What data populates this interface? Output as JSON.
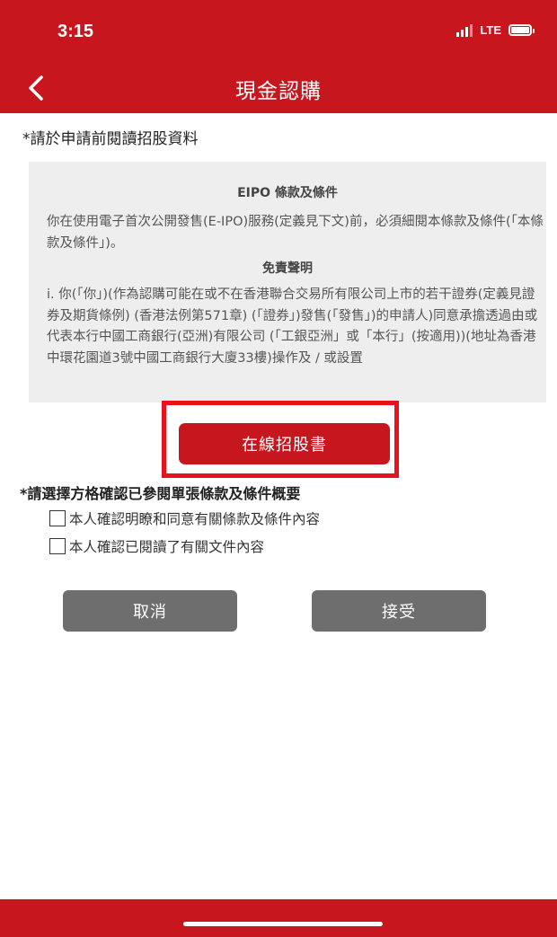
{
  "status_bar": {
    "time": "3:15",
    "network": "LTE"
  },
  "nav": {
    "title": "現金認購"
  },
  "prompt_read": "*請於申請前閱讀招股資料",
  "terms": {
    "title": "EIPO 條款及條件",
    "intro": "你在使用電子首次公開發售(E-IPO)服務(定義見下文)前，必須細閱本條款及條件(「本條款及條件」)。",
    "disclaimer_heading": "免責聲明",
    "disclaimer_text": "i. 你(「你」)(作為認購可能在或不在香港聯合交易所有限公司上市的若干證券(定義見證券及期貨條例) (香港法例第571章) (「證券」)發售(「發售」)的申請人)同意承擔透過由或代表本行中國工商銀行(亞洲)有限公司 (「工銀亞洲」或「本行」(按適用))(地址為香港中環花園道3號中國工商銀行大廈33樓)操作及 / 或設置"
  },
  "prospectus_button": "在線招股書",
  "select_prompt": "*請選擇方格確認已參閱單張條款及條件概要",
  "checkboxes": [
    {
      "label": "本人確認明瞭和同意有關條款及條件內容",
      "checked": false
    },
    {
      "label": "本人確認已閱讀了有關文件內容",
      "checked": false
    }
  ],
  "buttons": {
    "cancel": "取消",
    "accept": "接受"
  },
  "colors": {
    "brand_red": "#c8161e",
    "button_gray": "#6e6e6e",
    "highlight_red": "#e8111c"
  }
}
